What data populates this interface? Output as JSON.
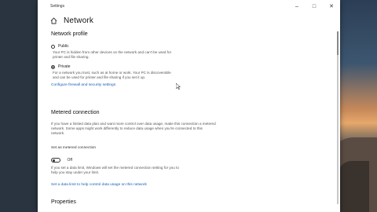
{
  "window": {
    "title": "Settings",
    "min_icon": "minimize-icon",
    "max_icon": "maximize-icon",
    "close_icon": "close-icon"
  },
  "header": {
    "home_icon": "home-icon",
    "title": "Network"
  },
  "network_profile": {
    "heading": "Network profile",
    "public": {
      "label": "Public",
      "selected": false,
      "description": "Your PC is hidden from other devices on the network and can't be used for printer and file sharing."
    },
    "private": {
      "label": "Private",
      "selected": true,
      "description": "For a network you trust, such as at home or work. Your PC is discoverable and can be used for printer and file sharing if you set it up."
    },
    "firewall_link": "Configure firewall and security settings"
  },
  "metered": {
    "heading": "Metered connection",
    "description": "If you have a limited data plan and want more control over data usage, make this connection a metered network. Some apps might work differently to reduce data usage when you're connected to this network.",
    "toggle_label": "Set as metered connection",
    "toggle_state": "Off",
    "limit_note": "If you set a data limit, Windows will set the metered connection setting for you to help you stay under your limit.",
    "data_limit_link": "Set a data limit to help control data usage on this network"
  },
  "properties": {
    "heading": "Properties"
  },
  "colors": {
    "accent": "#1a5fb4",
    "desktop_warm": "#e6a86b"
  }
}
